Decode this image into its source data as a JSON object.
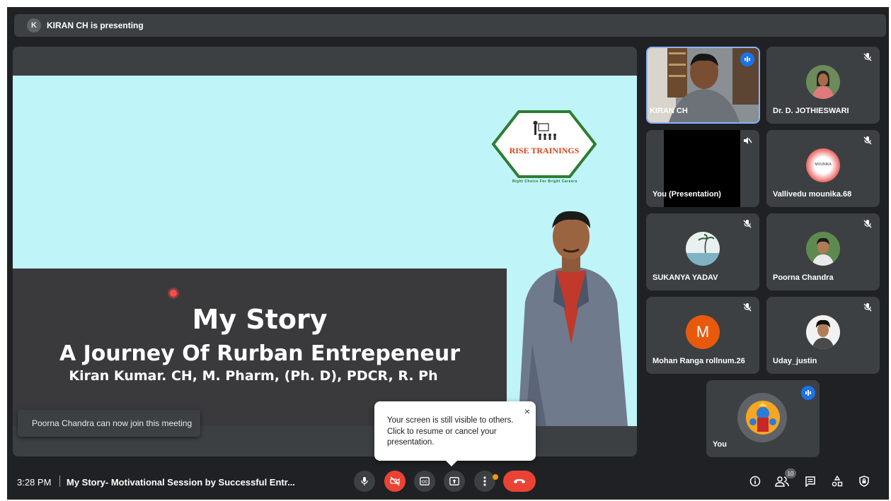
{
  "banner": {
    "avatar_letter": "K",
    "text": "KIRAN CH is presenting"
  },
  "slide": {
    "logo_text": "RISE TRAININGS",
    "logo_tagline": "Right Choice For Bright Careers",
    "title": "My Story",
    "subtitle": "A Journey Of Rurban Entrepeneur",
    "author": "Kiran Kumar. CH, M. Pharm, (Ph. D), PDCR, R. Ph"
  },
  "toast": {
    "text": "Poorna Chandra can now join this meeting"
  },
  "participants": [
    {
      "name": "KIRAN CH",
      "muted": false,
      "speaking": true
    },
    {
      "name": "Dr. D. JOTHIESWARI",
      "muted": true
    },
    {
      "name": "You (Presentation)",
      "muted": true
    },
    {
      "name": "Vallivedu mounika.68",
      "muted": true,
      "avatar_text": "MOUNIKA"
    },
    {
      "name": "SUKANYA YADAV",
      "muted": true
    },
    {
      "name": "Poorna Chandra",
      "muted": true
    },
    {
      "name": "Mohan Ranga rollnum.26",
      "muted": true,
      "avatar_letter": "M",
      "avatar_color": "#e8590c"
    },
    {
      "name": "Uday_justin",
      "muted": true
    },
    {
      "name": "You",
      "muted": false,
      "speaking": true
    }
  ],
  "popup": {
    "text": "Your screen is still visible to others. Click to resume or cancel your presentation.",
    "close_symbol": "×"
  },
  "bottom_bar": {
    "time": "3:28 PM",
    "separator": "|",
    "meeting_title": "My Story- Motivational Session by Successful Entr...",
    "people_count": "10"
  },
  "colors": {
    "background": "#202124",
    "tile": "#3c4043",
    "accent_blue": "#1a73e8",
    "danger_red": "#ea4335",
    "slide_cyan": "#bff4f8"
  }
}
